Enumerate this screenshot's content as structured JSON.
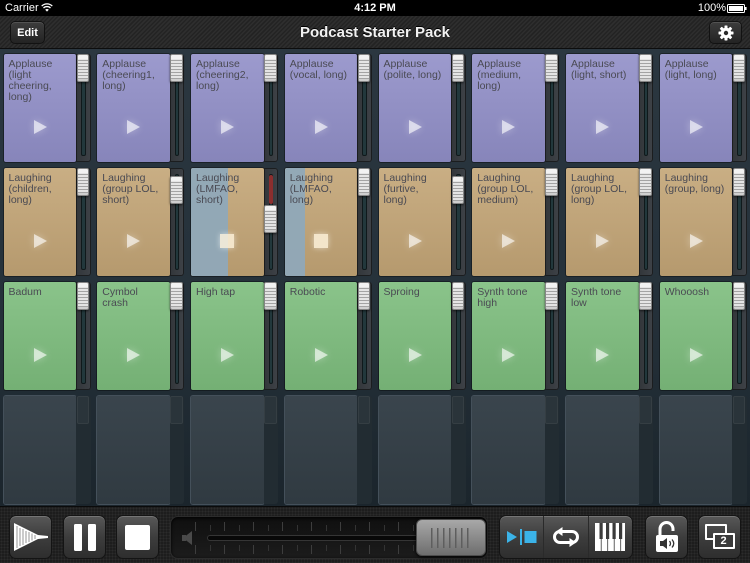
{
  "status_bar": {
    "carrier": "Carrier",
    "wifi_icon": "wifi-icon",
    "time": "4:12 PM",
    "battery_percent": "100%",
    "battery_icon": "battery-icon"
  },
  "header": {
    "edit_label": "Edit",
    "title": "Podcast Starter Pack",
    "settings_icon": "gear-icon"
  },
  "colors": {
    "applause": "#918fc8",
    "laughing": "#c3a576",
    "effects": "#7dbd7d",
    "empty": "#37424a",
    "playing_overlay": "#8ea8bb",
    "active_mode": "#3bb3e8",
    "level_meter": "#8c2e2e"
  },
  "pad_icons": {
    "stopped": "play-icon",
    "playing": "stop-icon"
  },
  "pad_rows": [
    {
      "group": "applause",
      "pads": [
        {
          "label": "Applause\n(light\ncheering,\nlong)",
          "volume": 1.0,
          "state": "stopped"
        },
        {
          "label": "Applause\n(cheering1,\nlong)",
          "volume": 1.0,
          "state": "stopped"
        },
        {
          "label": "Applause\n(cheering2,\nlong)",
          "volume": 1.0,
          "state": "stopped"
        },
        {
          "label": "Applause\n(vocal, long)",
          "volume": 1.0,
          "state": "stopped"
        },
        {
          "label": "Applause\n(polite, long)",
          "volume": 1.0,
          "state": "stopped"
        },
        {
          "label": "Applause\n(medium,\nlong)",
          "volume": 1.0,
          "state": "stopped"
        },
        {
          "label": "Applause\n(light, short)",
          "volume": 1.0,
          "state": "stopped"
        },
        {
          "label": "Applause\n(light, long)",
          "volume": 1.0,
          "state": "stopped"
        }
      ]
    },
    {
      "group": "laughing",
      "pads": [
        {
          "label": "Laughing\n(children,\nlong)",
          "volume": 1.0,
          "state": "stopped"
        },
        {
          "label": "Laughing\n(group LOL,\nshort)",
          "volume": 0.9,
          "state": "stopped"
        },
        {
          "label": "Laughing\n(LMFAO,\nshort)",
          "volume": 0.54,
          "state": "playing",
          "progress": 0.51,
          "meter_clipping": true
        },
        {
          "label": "Laughing\n(LMFAO,\nlong)",
          "volume": 1.0,
          "state": "playing",
          "progress": 0.28
        },
        {
          "label": "Laughing\n(furtive,\nlong)",
          "volume": 0.9,
          "state": "stopped"
        },
        {
          "label": "Laughing\n(group LOL,\nmedium)",
          "volume": 1.0,
          "state": "stopped"
        },
        {
          "label": "Laughing\n(group LOL,\nlong)",
          "volume": 1.0,
          "state": "stopped"
        },
        {
          "label": "Laughing\n(group, long)",
          "volume": 1.0,
          "state": "stopped"
        }
      ]
    },
    {
      "group": "effects",
      "pads": [
        {
          "label": "Badum",
          "volume": 1.0,
          "state": "stopped"
        },
        {
          "label": "Cymbol\ncrash",
          "volume": 1.0,
          "state": "stopped"
        },
        {
          "label": "High tap",
          "volume": 1.0,
          "state": "stopped"
        },
        {
          "label": "Robotic",
          "volume": 1.0,
          "state": "stopped"
        },
        {
          "label": "Sproing",
          "volume": 1.0,
          "state": "stopped"
        },
        {
          "label": "Synth tone\nhigh",
          "volume": 1.0,
          "state": "stopped"
        },
        {
          "label": "Synth tone\nlow",
          "volume": 1.0,
          "state": "stopped"
        },
        {
          "label": "Whooosh",
          "volume": 1.0,
          "state": "stopped"
        }
      ]
    },
    {
      "group": "empty",
      "pads": [
        {
          "empty": true
        },
        {
          "empty": true
        },
        {
          "empty": true
        },
        {
          "empty": true
        },
        {
          "empty": true
        },
        {
          "empty": true
        },
        {
          "empty": true
        },
        {
          "empty": true
        }
      ]
    }
  ],
  "toolbar": {
    "fade_button": {
      "icon": "fade-out-icon"
    },
    "pause_button": {
      "icon": "pause-icon"
    },
    "stop_button": {
      "icon": "stop-all-icon"
    },
    "master_volume": 1.0,
    "master_volume_icon": "speaker-low-icon",
    "mode_segments": [
      {
        "icon": "play-stop-mode-icon",
        "active": true
      },
      {
        "icon": "loop-icon",
        "active": false
      },
      {
        "icon": "piano-keys-icon",
        "active": false
      }
    ],
    "lock_button": {
      "icon": "lock-speaker-icon"
    },
    "page_button": {
      "icon": "pages-icon",
      "page_number": "2"
    }
  }
}
